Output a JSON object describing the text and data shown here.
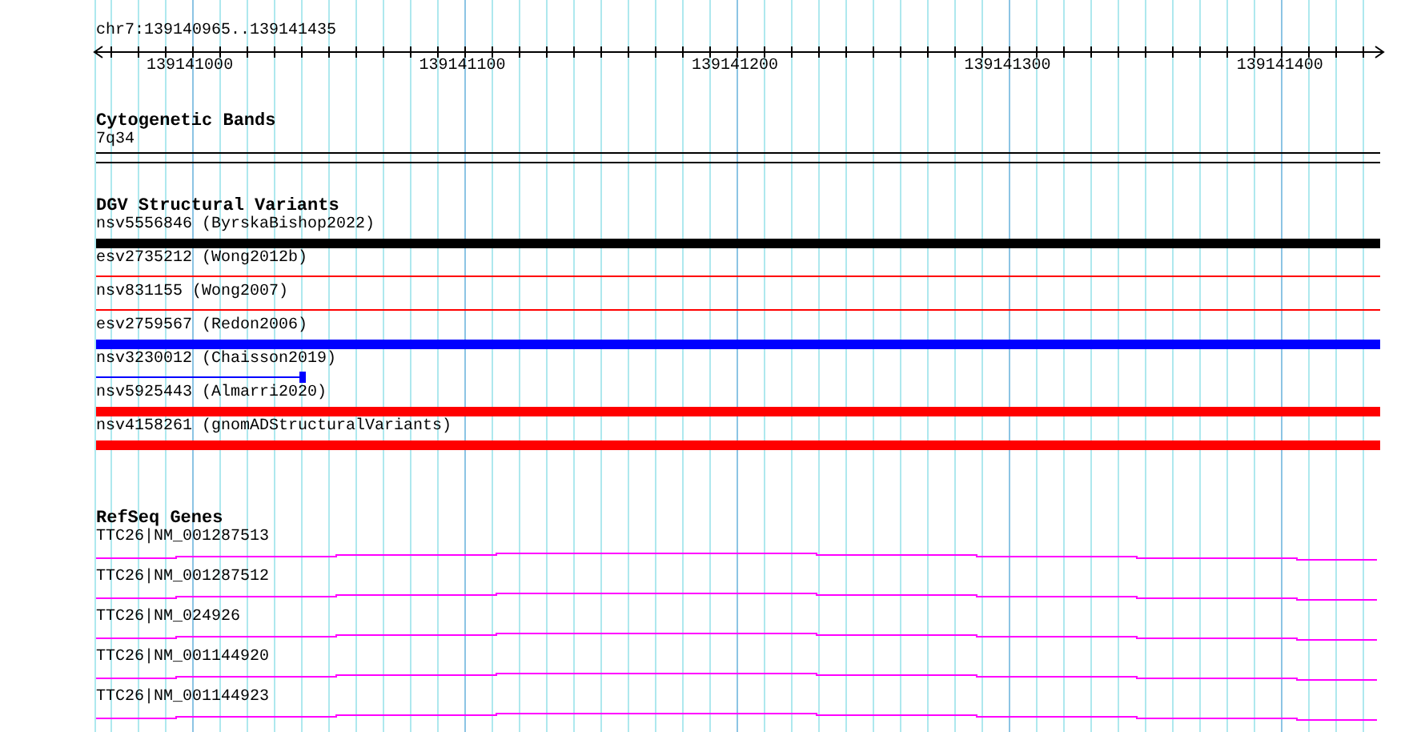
{
  "ruler": {
    "position": "chr7:139140965..139141435",
    "tick_labels": [
      "139141000",
      "139141100",
      "139141200",
      "139141300",
      "139141400"
    ]
  },
  "tracks": [
    {
      "kind": "bands",
      "title": "Cytogenetic Bands",
      "features": [
        {
          "label": "7q34"
        }
      ]
    },
    {
      "kind": "variants",
      "title": "DGV Structural Variants",
      "features": [
        {
          "label": "nsv5556846 (ByrskaBishop2022)",
          "kind": "thick",
          "color": "#000000"
        },
        {
          "label": "esv2735212 (Wong2012b)",
          "kind": "thin",
          "color": "#ff0000"
        },
        {
          "label": "nsv831155 (Wong2007)",
          "kind": "thin",
          "color": "#ff0000"
        },
        {
          "label": "esv2759567 (Redon2006)",
          "kind": "thick",
          "color": "#0000ff"
        },
        {
          "label": "nsv3230012 (Chaisson2019)",
          "kind": "partial",
          "color": "#0000ff"
        },
        {
          "label": "nsv5925443 (Almarri2020)",
          "kind": "thick",
          "color": "#ff0000"
        },
        {
          "label": "nsv4158261 (gnomADStructuralVariants)",
          "kind": "thick",
          "color": "#ff0000"
        }
      ]
    },
    {
      "kind": "genes",
      "title": "RefSeq Genes",
      "features": [
        {
          "label": "TTC26|NM_001287513"
        },
        {
          "label": "TTC26|NM_001287512"
        },
        {
          "label": "TTC26|NM_024926"
        },
        {
          "label": "TTC26|NM_001144920"
        },
        {
          "label": "TTC26|NM_001144923"
        }
      ]
    }
  ]
}
